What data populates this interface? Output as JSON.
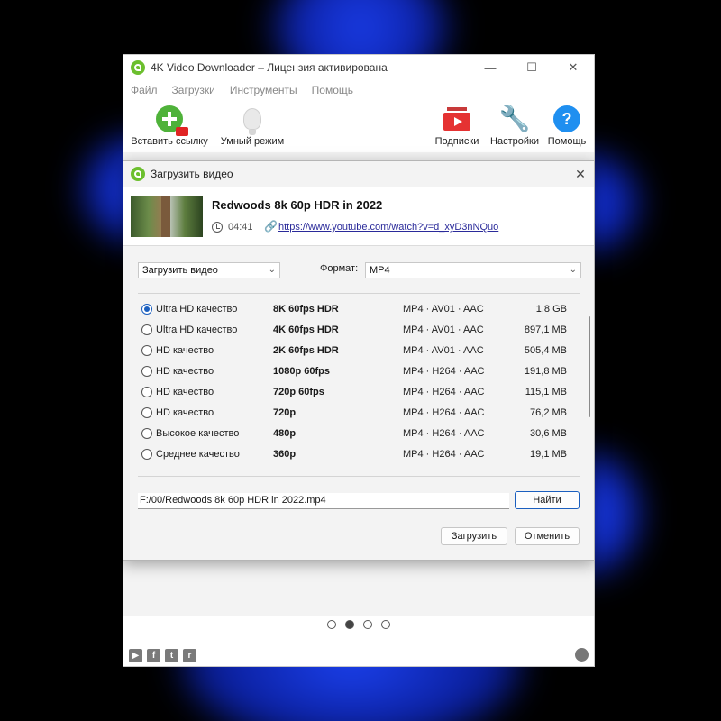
{
  "main_window": {
    "title": "4K Video Downloader – Лицензия активирована",
    "menu": [
      "Файл",
      "Загрузки",
      "Инструменты",
      "Помощь"
    ],
    "toolbar": {
      "paste_link": "Вставить ссылку",
      "smart_mode": "Умный режим",
      "subscriptions": "Подписки",
      "settings": "Настройки",
      "help": "Помощь"
    },
    "pager": {
      "total": 4,
      "active": 2
    }
  },
  "dialog": {
    "title": "Загрузить видео",
    "video": {
      "title": "Redwoods 8k 60p HDR in 2022",
      "duration": "04:41",
      "url": "https://www.youtube.com/watch?v=d_xyD3nNQuo"
    },
    "mode_select": "Загрузить видео",
    "format_label": "Формат:",
    "format_value": "MP4",
    "options": [
      {
        "quality": "Ultra HD качество",
        "resolution": "8K 60fps HDR",
        "codec": "MP4 · AV01 · AAC",
        "size": "1,8 GB",
        "selected": true
      },
      {
        "quality": "Ultra HD качество",
        "resolution": "4K 60fps HDR",
        "codec": "MP4 · AV01 · AAC",
        "size": "897,1 MB",
        "selected": false
      },
      {
        "quality": "HD качество",
        "resolution": "2K 60fps HDR",
        "codec": "MP4 · AV01 · AAC",
        "size": "505,4 MB",
        "selected": false
      },
      {
        "quality": "HD качество",
        "resolution": "1080p 60fps",
        "codec": "MP4 · H264 · AAC",
        "size": "191,8 MB",
        "selected": false
      },
      {
        "quality": "HD качество",
        "resolution": "720p 60fps",
        "codec": "MP4 · H264 · AAC",
        "size": "115,1 MB",
        "selected": false
      },
      {
        "quality": "HD качество",
        "resolution": "720p",
        "codec": "MP4 · H264 · AAC",
        "size": "76,2 MB",
        "selected": false
      },
      {
        "quality": "Высокое качество",
        "resolution": "480p",
        "codec": "MP4 · H264 · AAC",
        "size": "30,6 MB",
        "selected": false
      },
      {
        "quality": "Среднее качество",
        "resolution": "360p",
        "codec": "MP4 · H264 · AAC",
        "size": "19,1 MB",
        "selected": false
      }
    ],
    "path": "F:/00/Redwoods 8k 60p HDR in 2022.mp4",
    "browse_label": "Найти",
    "download_label": "Загрузить",
    "cancel_label": "Отменить"
  }
}
